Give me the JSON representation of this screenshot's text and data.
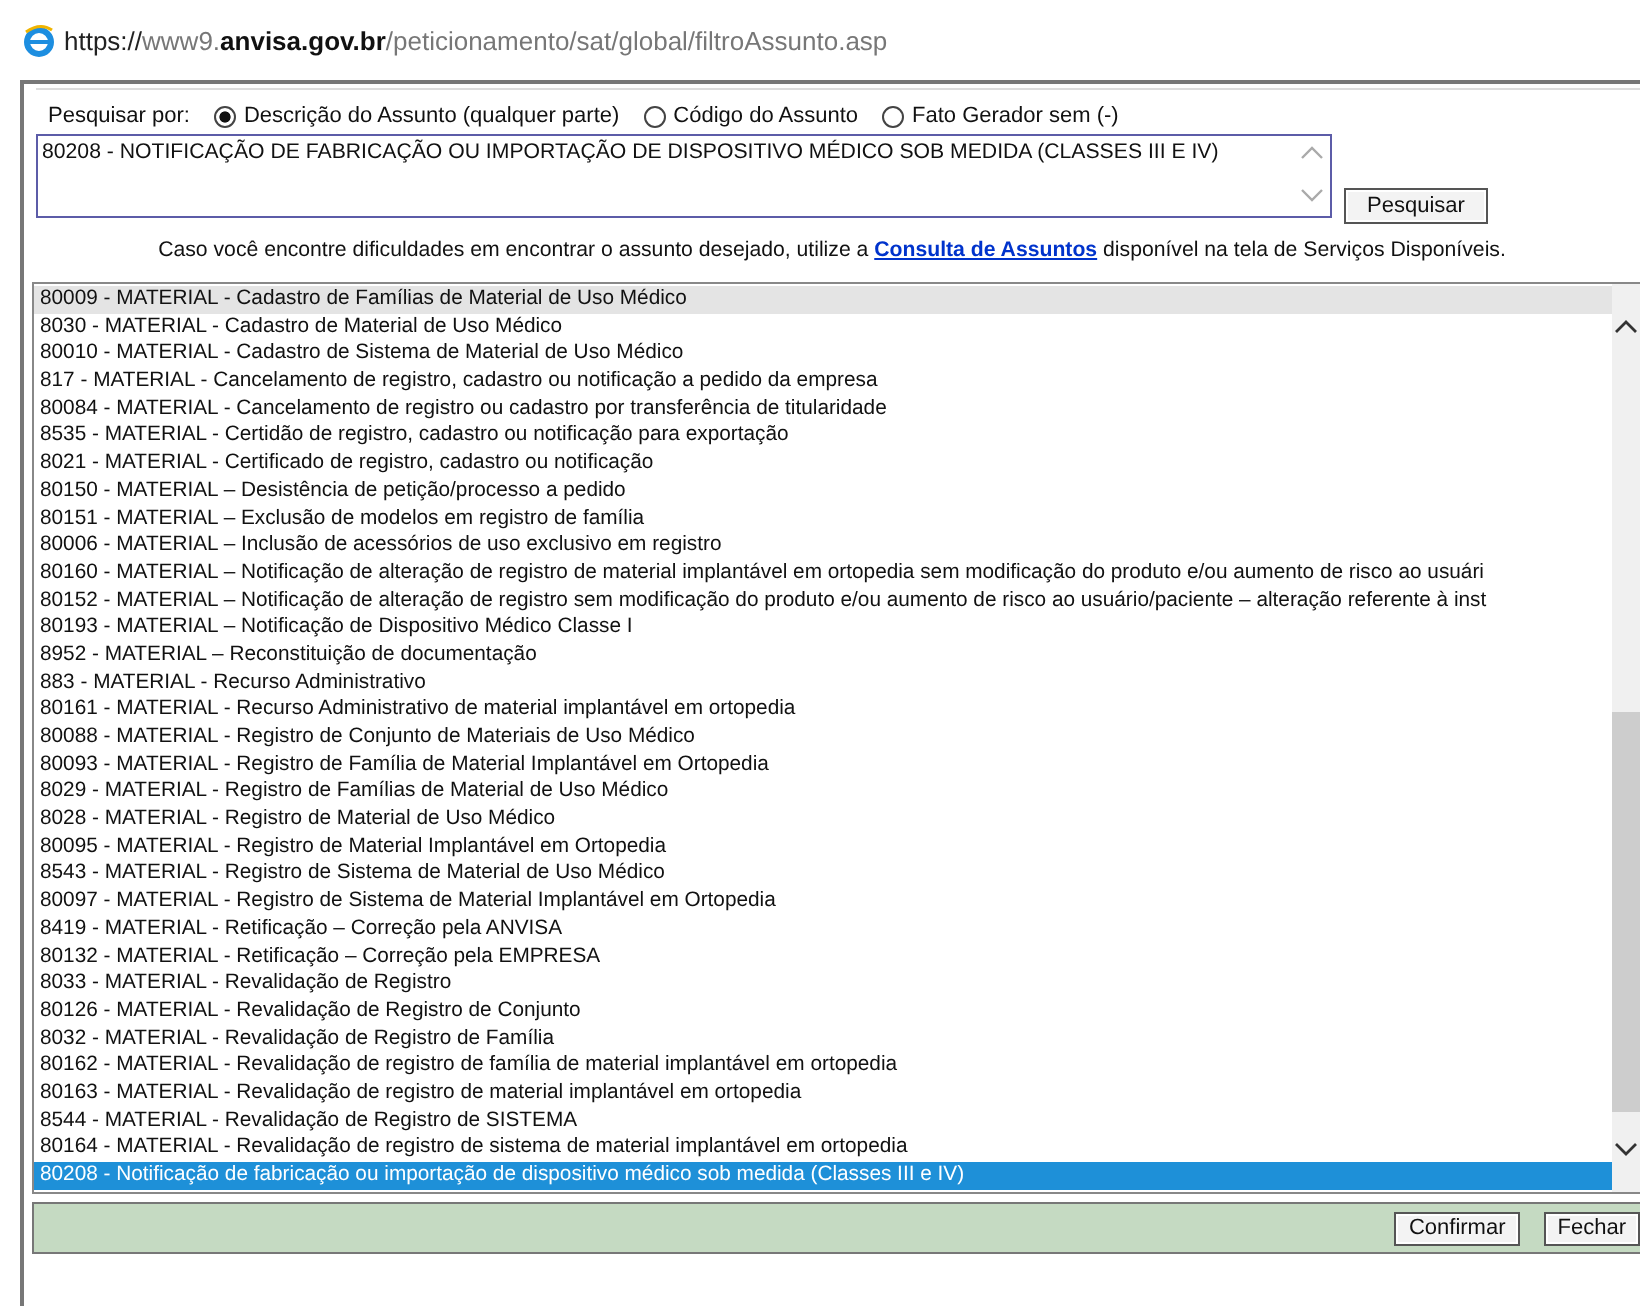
{
  "address_bar": {
    "scheme": "https://",
    "subdomain": "www9.",
    "domain": "anvisa.gov.br",
    "path": "/peticionamento/sat/global/filtroAssunto.asp"
  },
  "search": {
    "label": "Pesquisar por:",
    "options": [
      {
        "label": "Descrição do Assunto (qualquer parte)",
        "selected": true
      },
      {
        "label": "Código do Assunto",
        "selected": false
      },
      {
        "label": "Fato Gerador sem (-)",
        "selected": false
      }
    ],
    "value": "80208 - NOTIFICAÇÃO DE FABRICAÇÃO OU IMPORTAÇÃO DE DISPOSITIVO MÉDICO SOB MEDIDA (CLASSES III E IV)",
    "button": "Pesquisar"
  },
  "hint": {
    "before": "Caso você encontre dificuldades em encontrar o assunto desejado, utilize a ",
    "link": "Consulta de Assuntos",
    "after": " disponível na tela de Serviços Disponíveis."
  },
  "subjects": [
    {
      "text": "80009 - MATERIAL - Cadastro de Famílias de Material de Uso Médico",
      "selected": false,
      "hovered": true
    },
    {
      "text": "8030 - MATERIAL - Cadastro de Material de Uso Médico",
      "selected": false,
      "hovered": false
    },
    {
      "text": "80010 - MATERIAL - Cadastro de Sistema de Material de Uso Médico",
      "selected": false,
      "hovered": false
    },
    {
      "text": "817 - MATERIAL - Cancelamento de registro, cadastro ou notificação a pedido da empresa",
      "selected": false,
      "hovered": false
    },
    {
      "text": "80084 - MATERIAL - Cancelamento de registro ou cadastro por transferência de titularidade",
      "selected": false,
      "hovered": false
    },
    {
      "text": "8535 - MATERIAL - Certidão de registro, cadastro ou notificação para exportação",
      "selected": false,
      "hovered": false
    },
    {
      "text": "8021 - MATERIAL - Certificado de registro, cadastro ou notificação",
      "selected": false,
      "hovered": false
    },
    {
      "text": "80150 - MATERIAL – Desistência de petição/processo a pedido",
      "selected": false,
      "hovered": false
    },
    {
      "text": "80151 - MATERIAL – Exclusão de modelos em registro de família",
      "selected": false,
      "hovered": false
    },
    {
      "text": "80006 - MATERIAL – Inclusão de acessórios de uso exclusivo em registro",
      "selected": false,
      "hovered": false
    },
    {
      "text": "80160 - MATERIAL – Notificação de alteração de registro de material implantável em ortopedia sem modificação do produto e/ou aumento de risco ao usuári",
      "selected": false,
      "hovered": false
    },
    {
      "text": "80152 - MATERIAL – Notificação de alteração de registro sem modificação do produto e/ou aumento de risco ao usuário/paciente – alteração referente à inst",
      "selected": false,
      "hovered": false
    },
    {
      "text": "80193 - MATERIAL – Notificação de Dispositivo Médico Classe I",
      "selected": false,
      "hovered": false
    },
    {
      "text": "8952 - MATERIAL – Reconstituição de documentação",
      "selected": false,
      "hovered": false
    },
    {
      "text": "883 - MATERIAL - Recurso Administrativo",
      "selected": false,
      "hovered": false
    },
    {
      "text": "80161 - MATERIAL - Recurso Administrativo de material implantável em ortopedia",
      "selected": false,
      "hovered": false
    },
    {
      "text": "80088 - MATERIAL - Registro de Conjunto de Materiais de Uso Médico",
      "selected": false,
      "hovered": false
    },
    {
      "text": "80093 - MATERIAL - Registro de Família de Material Implantável em Ortopedia",
      "selected": false,
      "hovered": false
    },
    {
      "text": "8029 - MATERIAL - Registro de Famílias de Material de Uso Médico",
      "selected": false,
      "hovered": false
    },
    {
      "text": "8028 - MATERIAL - Registro de Material de Uso Médico",
      "selected": false,
      "hovered": false
    },
    {
      "text": "80095 - MATERIAL - Registro de Material Implantável em Ortopedia",
      "selected": false,
      "hovered": false
    },
    {
      "text": "8543 - MATERIAL - Registro de Sistema de Material de Uso Médico",
      "selected": false,
      "hovered": false
    },
    {
      "text": "80097 - MATERIAL - Registro de Sistema de Material Implantável em Ortopedia",
      "selected": false,
      "hovered": false
    },
    {
      "text": "8419 - MATERIAL - Retificação – Correção pela ANVISA",
      "selected": false,
      "hovered": false
    },
    {
      "text": "80132 - MATERIAL - Retificação – Correção pela EMPRESA",
      "selected": false,
      "hovered": false
    },
    {
      "text": "8033 - MATERIAL - Revalidação de Registro",
      "selected": false,
      "hovered": false
    },
    {
      "text": "80126 - MATERIAL - Revalidação de Registro de Conjunto",
      "selected": false,
      "hovered": false
    },
    {
      "text": "8032 - MATERIAL - Revalidação de Registro de Família",
      "selected": false,
      "hovered": false
    },
    {
      "text": "80162 - MATERIAL - Revalidação de registro de família de material implantável em ortopedia",
      "selected": false,
      "hovered": false
    },
    {
      "text": "80163 - MATERIAL - Revalidação de registro de material implantável em ortopedia",
      "selected": false,
      "hovered": false
    },
    {
      "text": "8544 - MATERIAL - Revalidação de Registro de SISTEMA",
      "selected": false,
      "hovered": false
    },
    {
      "text": "80164 - MATERIAL - Revalidação de registro de sistema de material implantável em ortopedia",
      "selected": false,
      "hovered": false
    },
    {
      "text": "80208 - Notificação de fabricação ou importação de dispositivo médico sob medida (Classes III e IV)",
      "selected": true,
      "hovered": false
    }
  ],
  "footer_buttons": [
    "Confirmar",
    "Fechar"
  ]
}
